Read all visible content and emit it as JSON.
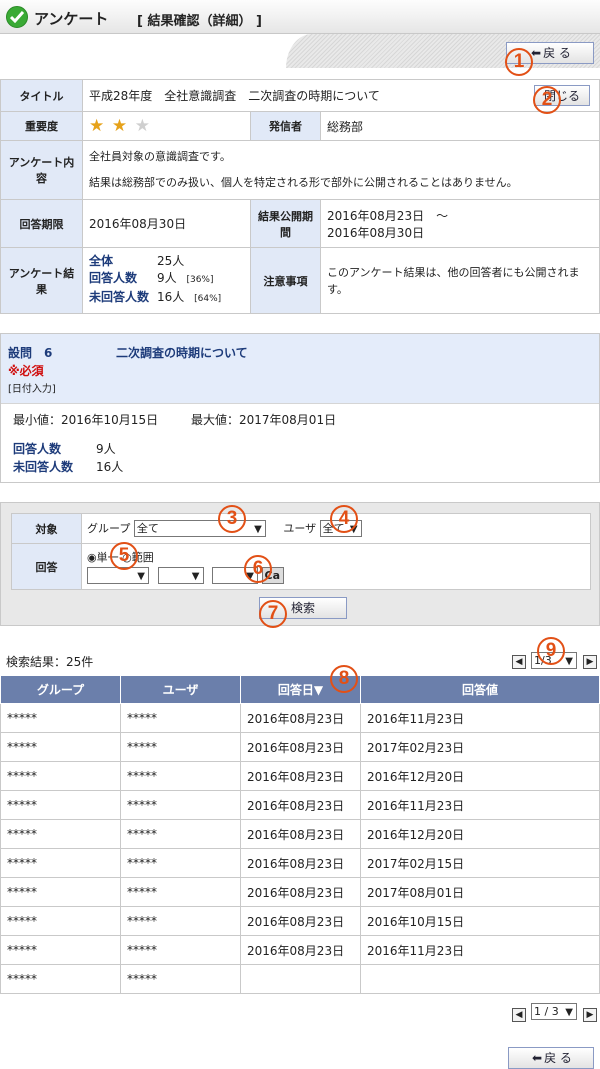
{
  "header": {
    "title": "アンケート",
    "subtitle": "[ 結果確認（詳細） ]"
  },
  "buttons": {
    "back": "戻 る",
    "close": "閉じる",
    "search": "検索"
  },
  "markers": [
    "1",
    "2",
    "3",
    "4",
    "5",
    "6",
    "7",
    "8",
    "9"
  ],
  "info": {
    "title_label": "タイトル",
    "title_value": "平成28年度　全社意識調査　二次調査の時期について",
    "importance_label": "重要度",
    "importance_rating": 2,
    "importance_max": 3,
    "sender_label": "発信者",
    "sender_value": "総務部",
    "content_label": "アンケート内容",
    "content_line1": "全社員対象の意識調査です。",
    "content_line2": "結果は総務部でのみ扱い、個人を特定される形で部外に公開されることはありません。",
    "deadline_label": "回答期限",
    "deadline_value": "2016年08月30日",
    "publish_label": "結果公開期間",
    "publish_from": "2016年08月23日　〜",
    "publish_to": "2016年08月30日",
    "result_label": "アンケート結果",
    "total_label": "全体",
    "total_value": "25人",
    "answered_label": "回答人数",
    "answered_value": "9人",
    "answered_pct": "[36%]",
    "unanswered_label": "未回答人数",
    "unanswered_value": "16人",
    "unanswered_pct": "[64%]",
    "notice_label": "注意事項",
    "notice_value": "このアンケート結果は、他の回答者にも公開されます。"
  },
  "question": {
    "num": "設問　6",
    "title": "二次調査の時期について",
    "required": "※必須",
    "type": "[日付入力]",
    "min": "最小値：2016年10月15日",
    "max": "最大値：2017年08月01日",
    "answered_label": "回答人数",
    "answered_value": "9人",
    "unanswered_label": "未回答人数",
    "unanswered_value": "16人"
  },
  "search": {
    "target_label": "対象",
    "group_label": "グループ",
    "group_value": "全て",
    "user_label": "ユーザ",
    "user_value": "全て",
    "answer_label": "回答",
    "radio_single": "単一",
    "radio_range": "範囲",
    "cal_label": "Ca"
  },
  "results": {
    "count": "検索結果：25件",
    "page_top": "1/3",
    "page_bottom": "1 / 3",
    "headers": [
      "グループ",
      "ユーザ",
      "回答日▼",
      "回答値"
    ],
    "rows": [
      [
        "*****",
        "*****",
        "2016年08月23日",
        "2016年11月23日"
      ],
      [
        "*****",
        "*****",
        "2016年08月23日",
        "2017年02月23日"
      ],
      [
        "*****",
        "*****",
        "2016年08月23日",
        "2016年12月20日"
      ],
      [
        "*****",
        "*****",
        "2016年08月23日",
        "2016年11月23日"
      ],
      [
        "*****",
        "*****",
        "2016年08月23日",
        "2016年12月20日"
      ],
      [
        "*****",
        "*****",
        "2016年08月23日",
        "2017年02月15日"
      ],
      [
        "*****",
        "*****",
        "2016年08月23日",
        "2017年08月01日"
      ],
      [
        "*****",
        "*****",
        "2016年08月23日",
        "2016年10月15日"
      ],
      [
        "*****",
        "*****",
        "2016年08月23日",
        "2016年11月23日"
      ],
      [
        "*****",
        "*****",
        "",
        ""
      ]
    ]
  }
}
